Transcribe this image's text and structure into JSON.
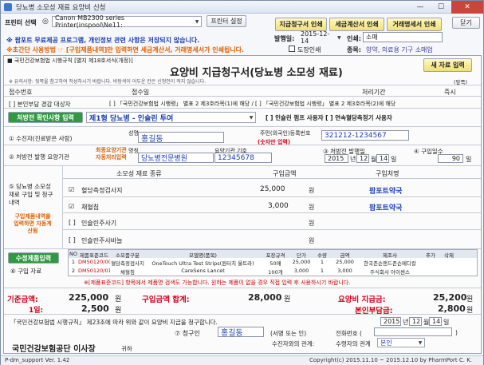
{
  "window": {
    "title": "당뇨병 소모성 재료 요양비 신청",
    "min": "—",
    "max": "☐",
    "close": "✕"
  },
  "top": {
    "printer_label": "프린터 선택",
    "printer_value": "Canon MB2300 series Printer(inspool\\Ne11:",
    "printer_setup": "프린터 설정",
    "btn_claim": "지급청구서 인쇄",
    "btn_tax": "세금계산서 인쇄",
    "btn_trade": "거래명세서 인쇄",
    "btn_close": "닫기",
    "notice1": "※ 팜포트 무료제공 프로그램, 개인정보 관련 사항은 저장되지 않습니다.",
    "notice2": "※초간단 사용방법 ☞ [구입제품내역]만 입력하면 세금계산서, 거래명세서가 인쇄됩니다.",
    "issue_date_label": "발행일:",
    "issue_date": "2015-12-14",
    "stamp_label": "인쇄:",
    "stamp_value": "소매",
    "dojang_label": "도장인쇄",
    "category_label": "종목:",
    "category_value": "양약, 의료용 기구 소매업"
  },
  "form": {
    "law_ref": "■ 국민건강보험법 시행규칙 [별지 제18호서식(개정)]",
    "title": "요양비 지급청구서(당뇨병 소모성 재료)",
    "new_btn": "새 자료 입력",
    "instructions": "※ 유의사항: 뒷쪽을 참고하여 작성하시기 바랍니다. 바탕색이 어두운 칸은 신청인이 적지 않습니다.",
    "page_side": "(앞쪽)",
    "h_receipt_no": "접수번호",
    "h_receipt_date": "접수일",
    "h_processing": "처리기간",
    "h_processing_val": "즉시",
    "h_type1": "[ ] 본인부담 경감 대상자",
    "h_type2": "[ ] 「국민건강보험법 시행령」 별표 2 제3호라목(1)에 해당  /  [ ] 「국민건강보험법 시행령」 별표 2 제3호라목(2)에 해당",
    "select_btn": "처방전 확인사항 입력",
    "patient_type": "제1형 당뇨병 - 인슐린 투여",
    "insulin_note": "[  ] 인슐린 펌프 사용자  [  ] 연속혈당측정기 사용자",
    "bank_label": "① 수진자(진료받은 사람)",
    "name_label": "성명",
    "name_value": "홍길동",
    "rrn_label": "주민(외국인)등록번호",
    "rrn_value": "321212-1234567",
    "rrn_note": "(숫자만 입력)",
    "prescription_label": "② 처방전 발행 요양기관",
    "presc_hint": "최종요양기관\n자동처리입력",
    "hosp_name_label": "명칭",
    "hosp_name_value": "당뇨병전문병원",
    "hosp_code_label": "요양기관 기호",
    "hosp_code_value": "12345678",
    "issue_label": "③ 처방전 발행일",
    "issue_y": "2015",
    "issue_m": "12",
    "issue_d": "14",
    "y": "년",
    "m": "월",
    "d": "일",
    "qty_label": "④ 구입일수",
    "qty_value": "90",
    "qty_unit": "일"
  },
  "items": {
    "section_label": "⑤ 당뇨병 소모성 재료 구입 및 청구내역",
    "hint": "구입제품내역을 입력하면 자동계산됨",
    "h_kind": "소모성 재료 종류",
    "h_amount": "구입금액",
    "h_place": "구입처명",
    "rows": [
      {
        "check": "☑",
        "name": "혈당측정검사지",
        "amount": "25,000",
        "unit": "원",
        "place": "팜포트약국"
      },
      {
        "check": "☑",
        "name": "채혈침",
        "amount": "3,000",
        "unit": "원",
        "place": "팜포트약국"
      },
      {
        "check": "[ ]",
        "name": "인슐린주사기",
        "amount": "",
        "unit": "원",
        "place": ""
      },
      {
        "check": "[ ]",
        "name": "인슐린주사바늘",
        "amount": "",
        "unit": "원",
        "place": ""
      }
    ]
  },
  "products": {
    "section_label": "⑥ 구입 자료",
    "entry_btn": "수정제품입력",
    "headers": [
      "NO",
      "제품표준코드",
      "소모품구분",
      "모델명(품목)",
      "포장규격",
      "단가",
      "수량",
      "금액",
      "제조사",
      "추가",
      "삭제"
    ],
    "rows": [
      [
        "1",
        "DM50120/0021",
        "혈당측정검사지",
        "OneTouch Ultra Test Strips(원터치 울트라)",
        "50매",
        "25,000",
        "1",
        "25,000",
        "한국존슨앤드존슨메디칼",
        "",
        ""
      ],
      [
        "2",
        "DM50120/0100",
        "채혈침",
        "CareSens Lancet",
        "100개",
        "3,000",
        "1",
        "3,000",
        "주식회사 아이센스",
        "",
        ""
      ]
    ],
    "footer": "※[제품표준코드] 항목에서 제품명 검색도 가능합니다. 원하는 제품이 없을 경우 직접 입력 후 사용하시기 바랍니다."
  },
  "totals": {
    "base_label": "기준금액:",
    "base_value": "225,000",
    "base_unit": "원",
    "total_label": "구입금액 합계:",
    "total_value": "28,000",
    "total_unit": "원",
    "pay_label": "요양비 지급금:",
    "pay_value": "25,200",
    "pay_unit": "원",
    "daily_label": "1일:",
    "daily_value": "2,500",
    "daily_unit": "원",
    "self_label": "본인부담금:",
    "self_value": "2,800",
    "self_unit": "원"
  },
  "sign": {
    "law_text": "「국민건강보험법 시행규칙」 제23조에 따라 위와 같이 요양비 지급을 청구합니다.",
    "date_y": "2015",
    "date_m": "12",
    "date_d": "14",
    "applicant_label": "⑦ 청구인",
    "applicant_name": "홍길동",
    "sign_note": "(서명 또는 인)",
    "phone_label": "전화번호 (",
    "phone_close": ")",
    "relation_label": "수진자와의 관계:",
    "relation_value": "본인",
    "receiver_label": "수령자의 관계",
    "recipient": "국민건강보험공단 이사장",
    "recipient_suffix": "귀하"
  },
  "status": {
    "left": "P-dm_support Ver. 1.42",
    "right": "Copyright(c) 2015.11.10 ~ 2015.12.10 by PharmPort C. K."
  }
}
